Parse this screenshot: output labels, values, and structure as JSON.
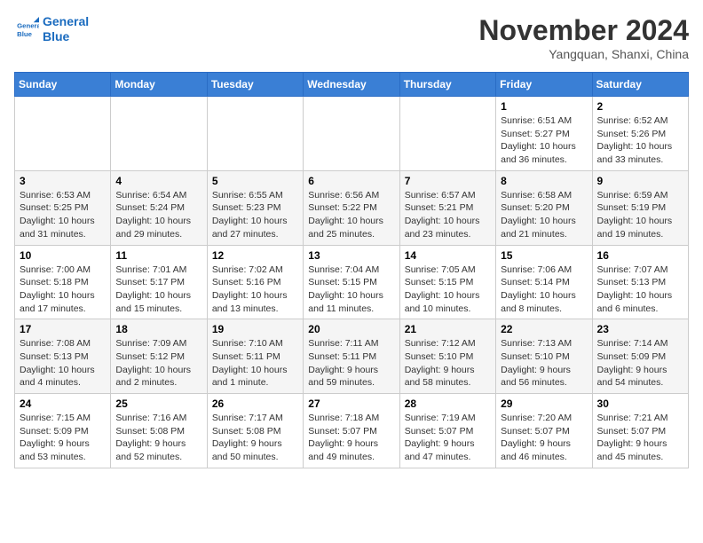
{
  "header": {
    "logo_line1": "General",
    "logo_line2": "Blue",
    "month": "November 2024",
    "location": "Yangquan, Shanxi, China"
  },
  "weekdays": [
    "Sunday",
    "Monday",
    "Tuesday",
    "Wednesday",
    "Thursday",
    "Friday",
    "Saturday"
  ],
  "weeks": [
    [
      {
        "day": "",
        "info": ""
      },
      {
        "day": "",
        "info": ""
      },
      {
        "day": "",
        "info": ""
      },
      {
        "day": "",
        "info": ""
      },
      {
        "day": "",
        "info": ""
      },
      {
        "day": "1",
        "info": "Sunrise: 6:51 AM\nSunset: 5:27 PM\nDaylight: 10 hours and 36 minutes."
      },
      {
        "day": "2",
        "info": "Sunrise: 6:52 AM\nSunset: 5:26 PM\nDaylight: 10 hours and 33 minutes."
      }
    ],
    [
      {
        "day": "3",
        "info": "Sunrise: 6:53 AM\nSunset: 5:25 PM\nDaylight: 10 hours and 31 minutes."
      },
      {
        "day": "4",
        "info": "Sunrise: 6:54 AM\nSunset: 5:24 PM\nDaylight: 10 hours and 29 minutes."
      },
      {
        "day": "5",
        "info": "Sunrise: 6:55 AM\nSunset: 5:23 PM\nDaylight: 10 hours and 27 minutes."
      },
      {
        "day": "6",
        "info": "Sunrise: 6:56 AM\nSunset: 5:22 PM\nDaylight: 10 hours and 25 minutes."
      },
      {
        "day": "7",
        "info": "Sunrise: 6:57 AM\nSunset: 5:21 PM\nDaylight: 10 hours and 23 minutes."
      },
      {
        "day": "8",
        "info": "Sunrise: 6:58 AM\nSunset: 5:20 PM\nDaylight: 10 hours and 21 minutes."
      },
      {
        "day": "9",
        "info": "Sunrise: 6:59 AM\nSunset: 5:19 PM\nDaylight: 10 hours and 19 minutes."
      }
    ],
    [
      {
        "day": "10",
        "info": "Sunrise: 7:00 AM\nSunset: 5:18 PM\nDaylight: 10 hours and 17 minutes."
      },
      {
        "day": "11",
        "info": "Sunrise: 7:01 AM\nSunset: 5:17 PM\nDaylight: 10 hours and 15 minutes."
      },
      {
        "day": "12",
        "info": "Sunrise: 7:02 AM\nSunset: 5:16 PM\nDaylight: 10 hours and 13 minutes."
      },
      {
        "day": "13",
        "info": "Sunrise: 7:04 AM\nSunset: 5:15 PM\nDaylight: 10 hours and 11 minutes."
      },
      {
        "day": "14",
        "info": "Sunrise: 7:05 AM\nSunset: 5:15 PM\nDaylight: 10 hours and 10 minutes."
      },
      {
        "day": "15",
        "info": "Sunrise: 7:06 AM\nSunset: 5:14 PM\nDaylight: 10 hours and 8 minutes."
      },
      {
        "day": "16",
        "info": "Sunrise: 7:07 AM\nSunset: 5:13 PM\nDaylight: 10 hours and 6 minutes."
      }
    ],
    [
      {
        "day": "17",
        "info": "Sunrise: 7:08 AM\nSunset: 5:13 PM\nDaylight: 10 hours and 4 minutes."
      },
      {
        "day": "18",
        "info": "Sunrise: 7:09 AM\nSunset: 5:12 PM\nDaylight: 10 hours and 2 minutes."
      },
      {
        "day": "19",
        "info": "Sunrise: 7:10 AM\nSunset: 5:11 PM\nDaylight: 10 hours and 1 minute."
      },
      {
        "day": "20",
        "info": "Sunrise: 7:11 AM\nSunset: 5:11 PM\nDaylight: 9 hours and 59 minutes."
      },
      {
        "day": "21",
        "info": "Sunrise: 7:12 AM\nSunset: 5:10 PM\nDaylight: 9 hours and 58 minutes."
      },
      {
        "day": "22",
        "info": "Sunrise: 7:13 AM\nSunset: 5:10 PM\nDaylight: 9 hours and 56 minutes."
      },
      {
        "day": "23",
        "info": "Sunrise: 7:14 AM\nSunset: 5:09 PM\nDaylight: 9 hours and 54 minutes."
      }
    ],
    [
      {
        "day": "24",
        "info": "Sunrise: 7:15 AM\nSunset: 5:09 PM\nDaylight: 9 hours and 53 minutes."
      },
      {
        "day": "25",
        "info": "Sunrise: 7:16 AM\nSunset: 5:08 PM\nDaylight: 9 hours and 52 minutes."
      },
      {
        "day": "26",
        "info": "Sunrise: 7:17 AM\nSunset: 5:08 PM\nDaylight: 9 hours and 50 minutes."
      },
      {
        "day": "27",
        "info": "Sunrise: 7:18 AM\nSunset: 5:07 PM\nDaylight: 9 hours and 49 minutes."
      },
      {
        "day": "28",
        "info": "Sunrise: 7:19 AM\nSunset: 5:07 PM\nDaylight: 9 hours and 47 minutes."
      },
      {
        "day": "29",
        "info": "Sunrise: 7:20 AM\nSunset: 5:07 PM\nDaylight: 9 hours and 46 minutes."
      },
      {
        "day": "30",
        "info": "Sunrise: 7:21 AM\nSunset: 5:07 PM\nDaylight: 9 hours and 45 minutes."
      }
    ]
  ]
}
